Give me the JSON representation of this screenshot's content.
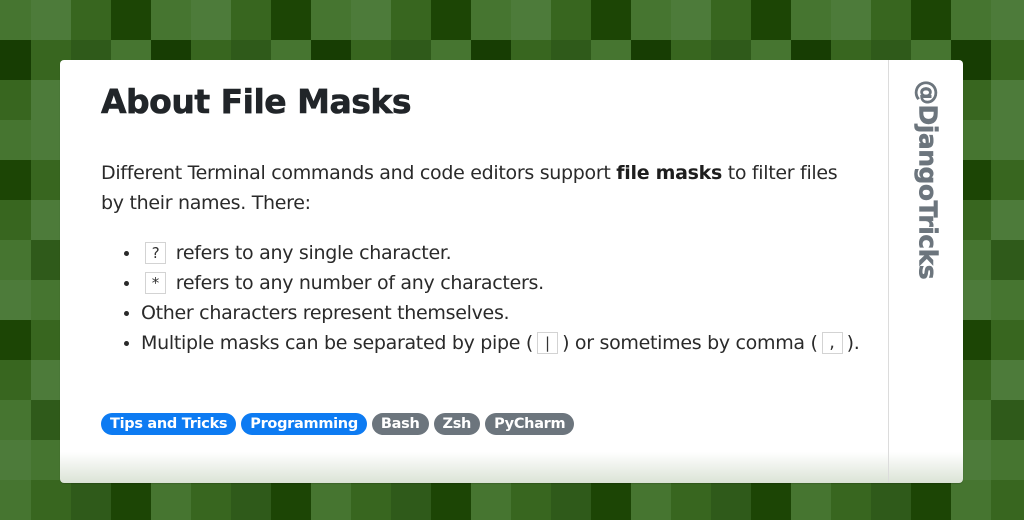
{
  "background": {
    "palette": [
      "#467530",
      "#4d7b3a",
      "#38661f",
      "#1c4505",
      "#173d03",
      "#2f5a1a"
    ],
    "rows": [
      [
        0,
        1,
        2,
        3,
        0,
        1,
        2,
        3,
        0,
        1,
        2,
        3,
        0,
        1,
        2,
        3,
        0,
        1,
        2,
        3,
        0,
        1,
        2,
        3,
        0,
        1,
        2
      ],
      [
        4,
        2,
        5,
        0,
        4,
        2,
        5,
        0,
        4,
        2,
        5,
        0,
        4,
        2,
        5,
        0,
        4,
        2,
        5,
        0,
        4,
        2,
        5,
        0,
        4,
        2,
        5
      ],
      [
        2,
        1,
        5,
        0,
        2,
        1,
        5,
        0,
        2,
        1,
        5,
        0,
        2,
        1,
        5,
        0,
        2,
        1,
        5,
        0,
        2,
        1,
        5,
        0,
        2,
        1,
        5
      ],
      [
        0,
        1,
        0,
        1,
        0,
        1,
        0,
        1,
        0,
        1,
        0,
        1,
        0,
        1,
        0,
        1,
        0,
        1,
        0,
        1,
        0,
        1,
        0,
        1,
        0,
        1,
        0
      ],
      [
        3,
        2,
        0,
        1,
        3,
        2,
        0,
        1,
        3,
        2,
        0,
        1,
        3,
        2,
        0,
        1,
        3,
        2,
        0,
        1,
        3,
        2,
        0,
        1,
        3,
        2,
        0
      ],
      [
        2,
        1,
        5,
        0,
        2,
        1,
        5,
        0,
        2,
        1,
        5,
        0,
        2,
        1,
        5,
        0,
        2,
        1,
        5,
        0,
        2,
        1,
        5,
        0,
        2,
        1,
        5
      ],
      [
        0,
        5,
        2,
        1,
        0,
        5,
        2,
        1,
        0,
        5,
        2,
        1,
        0,
        5,
        2,
        1,
        0,
        5,
        2,
        1,
        0,
        5,
        2,
        1,
        0,
        5,
        2
      ],
      [
        1,
        0,
        5,
        3,
        1,
        0,
        5,
        3,
        1,
        0,
        5,
        3,
        1,
        0,
        5,
        3,
        1,
        0,
        5,
        3,
        1,
        0,
        5,
        3,
        1,
        0,
        5
      ],
      [
        3,
        2,
        0,
        1,
        3,
        2,
        0,
        1,
        3,
        2,
        0,
        1,
        3,
        2,
        0,
        1,
        3,
        2,
        0,
        1,
        3,
        2,
        0,
        1,
        3,
        2,
        0
      ],
      [
        2,
        1,
        5,
        0,
        2,
        1,
        5,
        0,
        2,
        1,
        5,
        0,
        2,
        1,
        5,
        0,
        2,
        1,
        5,
        0,
        2,
        1,
        5,
        0,
        2,
        1,
        5
      ],
      [
        0,
        5,
        2,
        1,
        0,
        5,
        2,
        1,
        0,
        5,
        2,
        1,
        0,
        5,
        2,
        1,
        0,
        5,
        2,
        1,
        0,
        5,
        2,
        1,
        0,
        5,
        2
      ],
      [
        1,
        0,
        5,
        3,
        1,
        0,
        5,
        3,
        1,
        0,
        5,
        3,
        1,
        0,
        5,
        3,
        1,
        0,
        5,
        3,
        1,
        0,
        5,
        3,
        1,
        0,
        5
      ],
      [
        0,
        2,
        5,
        3,
        0,
        2,
        5,
        3,
        0,
        2,
        5,
        3,
        0,
        2,
        5,
        3,
        0,
        2,
        5,
        3,
        0,
        2,
        5,
        3,
        0,
        2,
        5
      ]
    ]
  },
  "card": {
    "title": "About File Masks",
    "intro": {
      "before": "Different Terminal commands and code editors support ",
      "bold": "file masks",
      "after": " to filter files by their names. There:"
    },
    "bullets": [
      {
        "code": "?",
        "text": "refers to any single character."
      },
      {
        "code": "*",
        "text": "refers to any number of any characters."
      },
      {
        "text": "Other characters represent themselves."
      },
      {
        "before": "Multiple masks can be separated by pipe (",
        "code1": "|",
        "middle": ") or sometimes by comma (",
        "code2": ",",
        "after": ")."
      }
    ],
    "tags": [
      {
        "label": "Tips and Tricks",
        "color": "#0d7bf2"
      },
      {
        "label": "Programming",
        "color": "#0d7bf2"
      },
      {
        "label": "Bash",
        "color": "#6c757d"
      },
      {
        "label": "Zsh",
        "color": "#6c757d"
      },
      {
        "label": "PyCharm",
        "color": "#6c757d"
      }
    ],
    "handle": "@DjangoTricks"
  }
}
